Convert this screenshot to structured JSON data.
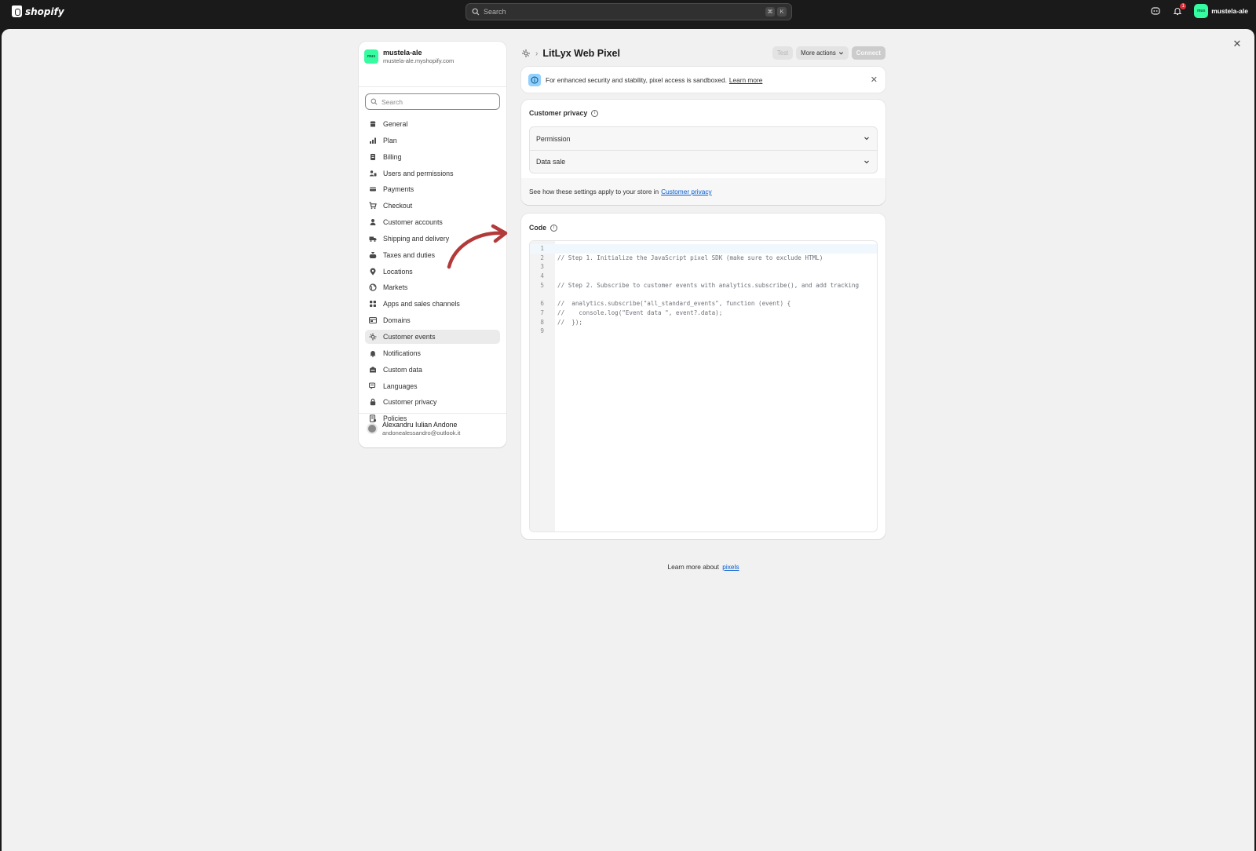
{
  "topbar": {
    "brand": "shopify",
    "search_placeholder": "Search",
    "shortcut_keys": [
      "⌘",
      "K"
    ],
    "notification_count": "1",
    "store_avatar": "mus",
    "store_name": "mustela-ale"
  },
  "settings": {
    "close_label": "✕",
    "store": {
      "avatar": "mus",
      "name": "mustela-ale",
      "domain": "mustela-ale.myshopify.com"
    },
    "search_placeholder": "Search",
    "nav_items": [
      {
        "label": "General",
        "icon": "store-icon"
      },
      {
        "label": "Plan",
        "icon": "plan-icon"
      },
      {
        "label": "Billing",
        "icon": "billing-icon"
      },
      {
        "label": "Users and permissions",
        "icon": "users-icon"
      },
      {
        "label": "Payments",
        "icon": "payments-icon"
      },
      {
        "label": "Checkout",
        "icon": "cart-icon"
      },
      {
        "label": "Customer accounts",
        "icon": "person-icon"
      },
      {
        "label": "Shipping and delivery",
        "icon": "truck-icon"
      },
      {
        "label": "Taxes and duties",
        "icon": "taxes-icon"
      },
      {
        "label": "Locations",
        "icon": "location-icon"
      },
      {
        "label": "Markets",
        "icon": "globe-icon"
      },
      {
        "label": "Apps and sales channels",
        "icon": "apps-icon"
      },
      {
        "label": "Domains",
        "icon": "domains-icon"
      },
      {
        "label": "Customer events",
        "icon": "pixel-icon",
        "active": true
      },
      {
        "label": "Notifications",
        "icon": "bell-icon"
      },
      {
        "label": "Custom data",
        "icon": "data-icon"
      },
      {
        "label": "Languages",
        "icon": "languages-icon"
      },
      {
        "label": "Customer privacy",
        "icon": "lock-icon"
      },
      {
        "label": "Policies",
        "icon": "policies-icon"
      }
    ],
    "user": {
      "name": "Alexandru Iulian Andone",
      "email": "andonealessandro@outlook.it"
    }
  },
  "page": {
    "title": "LitLyx Web Pixel",
    "actions": {
      "test": "Test",
      "more": "More actions",
      "connect": "Connect"
    },
    "banner": {
      "text": "For enhanced security and stability, pixel access is sandboxed.",
      "link": "Learn more"
    },
    "privacy": {
      "title": "Customer privacy",
      "rows": [
        "Permission",
        "Data sale"
      ],
      "footer_text": "See how these settings apply to your store in",
      "footer_link": "Customer privacy"
    },
    "code": {
      "title": "Code",
      "lines": [
        {
          "n": "1",
          "text": ""
        },
        {
          "n": "2",
          "text": "// Step 1. Initialize the JavaScript pixel SDK (make sure to exclude HTML)"
        },
        {
          "n": "3",
          "text": ""
        },
        {
          "n": "4",
          "text": ""
        },
        {
          "n": "5",
          "text": "// Step 2. Subscribe to customer events with analytics.subscribe(), and add tracking"
        },
        {
          "n": "6",
          "text": "//  analytics.subscribe(\"all_standard_events\", function (event) {"
        },
        {
          "n": "7",
          "text": "//    console.log(\"Event data \", event?.data);"
        },
        {
          "n": "8",
          "text": "//  });"
        },
        {
          "n": "9",
          "text": ""
        }
      ]
    },
    "learn_more_text": "Learn more about",
    "learn_more_link": "pixels"
  },
  "colors": {
    "topbar": "#1a1a1a",
    "store_avatar": "#36fba1",
    "link": "#005bd3",
    "annotation_arrow": "#b33a3a"
  }
}
